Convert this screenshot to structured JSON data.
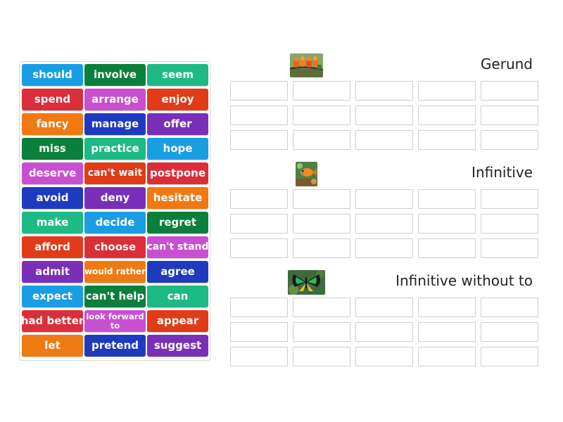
{
  "word_bank": [
    {
      "label": "should",
      "color": "#1a9ee3",
      "size": ""
    },
    {
      "label": "involve",
      "color": "#0b7f3c",
      "size": ""
    },
    {
      "label": "seem",
      "color": "#1dba85",
      "size": ""
    },
    {
      "label": "spend",
      "color": "#db2e39",
      "size": ""
    },
    {
      "label": "arrange",
      "color": "#c94fd1",
      "size": ""
    },
    {
      "label": "enjoy",
      "color": "#e23b17",
      "size": ""
    },
    {
      "label": "fancy",
      "color": "#f07a12",
      "size": ""
    },
    {
      "label": "manage",
      "color": "#1e3bbf",
      "size": ""
    },
    {
      "label": "offer",
      "color": "#7a2fb8",
      "size": ""
    },
    {
      "label": "miss",
      "color": "#0b7f3c",
      "size": ""
    },
    {
      "label": "practice",
      "color": "#1dba85",
      "size": ""
    },
    {
      "label": "hope",
      "color": "#1a9ee3",
      "size": ""
    },
    {
      "label": "deserve",
      "color": "#c94fd1",
      "size": ""
    },
    {
      "label": "can't wait",
      "color": "#e23b17",
      "size": "mid"
    },
    {
      "label": "postpone",
      "color": "#db2e39",
      "size": ""
    },
    {
      "label": "avoid",
      "color": "#1e3bbf",
      "size": ""
    },
    {
      "label": "deny",
      "color": "#7a2fb8",
      "size": ""
    },
    {
      "label": "hesitate",
      "color": "#f07a12",
      "size": ""
    },
    {
      "label": "make",
      "color": "#1dba85",
      "size": ""
    },
    {
      "label": "decide",
      "color": "#1a9ee3",
      "size": ""
    },
    {
      "label": "regret",
      "color": "#0b7f3c",
      "size": ""
    },
    {
      "label": "afford",
      "color": "#e23b17",
      "size": ""
    },
    {
      "label": "choose",
      "color": "#db2e39",
      "size": ""
    },
    {
      "label": "can't stand",
      "color": "#c94fd1",
      "size": "mid"
    },
    {
      "label": "admit",
      "color": "#7a2fb8",
      "size": ""
    },
    {
      "label": "would rather",
      "color": "#f07a12",
      "size": "small"
    },
    {
      "label": "agree",
      "color": "#1e3bbf",
      "size": ""
    },
    {
      "label": "expect",
      "color": "#1a9ee3",
      "size": ""
    },
    {
      "label": "can't help",
      "color": "#0b7f3c",
      "size": ""
    },
    {
      "label": "can",
      "color": "#1dba85",
      "size": ""
    },
    {
      "label": "had better",
      "color": "#db2e39",
      "size": ""
    },
    {
      "label": "look forward to",
      "color": "#c94fd1",
      "size": "tiny"
    },
    {
      "label": "appear",
      "color": "#e23b17",
      "size": ""
    },
    {
      "label": "let",
      "color": "#f07a12",
      "size": ""
    },
    {
      "label": "pretend",
      "color": "#1e3bbf",
      "size": ""
    },
    {
      "label": "suggest",
      "color": "#7a2fb8",
      "size": ""
    }
  ],
  "groups": [
    {
      "title": "Gerund",
      "image": "birds-thumbnail"
    },
    {
      "title": "Infinitive",
      "image": "fish-thumbnail"
    },
    {
      "title": "Infinitive without to",
      "image": "butterfly-thumbnail"
    }
  ]
}
